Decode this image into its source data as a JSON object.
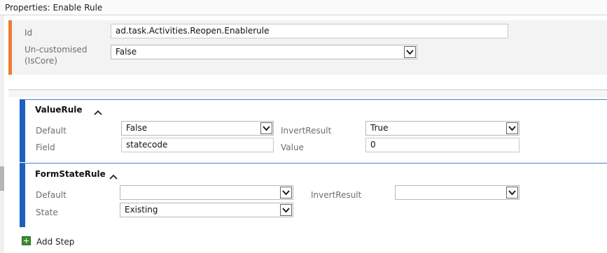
{
  "window": {
    "title": "Properties: Enable Rule"
  },
  "properties": {
    "id_label": "Id",
    "id_value": "ad.task.Activities.Reopen.Enablerule",
    "uncustomised_label_line1": "Un-customised",
    "uncustomised_label_line2": "(IsCore)",
    "uncustomised_value": "False"
  },
  "value_rule": {
    "title": "ValueRule",
    "default_label": "Default",
    "default_value": "False",
    "invert_label": "InvertResult",
    "invert_value": "True",
    "field_label": "Field",
    "field_value": "statecode",
    "value_label": "Value",
    "value_value": "0"
  },
  "form_state_rule": {
    "title": "FormStateRule",
    "default_label": "Default",
    "default_value": "",
    "invert_label": "InvertResult",
    "invert_value": "",
    "state_label": "State",
    "state_value": "Existing"
  },
  "footer": {
    "add_step_label": "Add Step"
  },
  "colors": {
    "accent_orange": "#ed7d31",
    "section_blue": "#1e5fc1",
    "add_green": "#3a8a30"
  },
  "icons": {
    "collapse": "chevron-up-icon",
    "dropdown": "chevron-down-icon",
    "add": "plus-icon"
  }
}
